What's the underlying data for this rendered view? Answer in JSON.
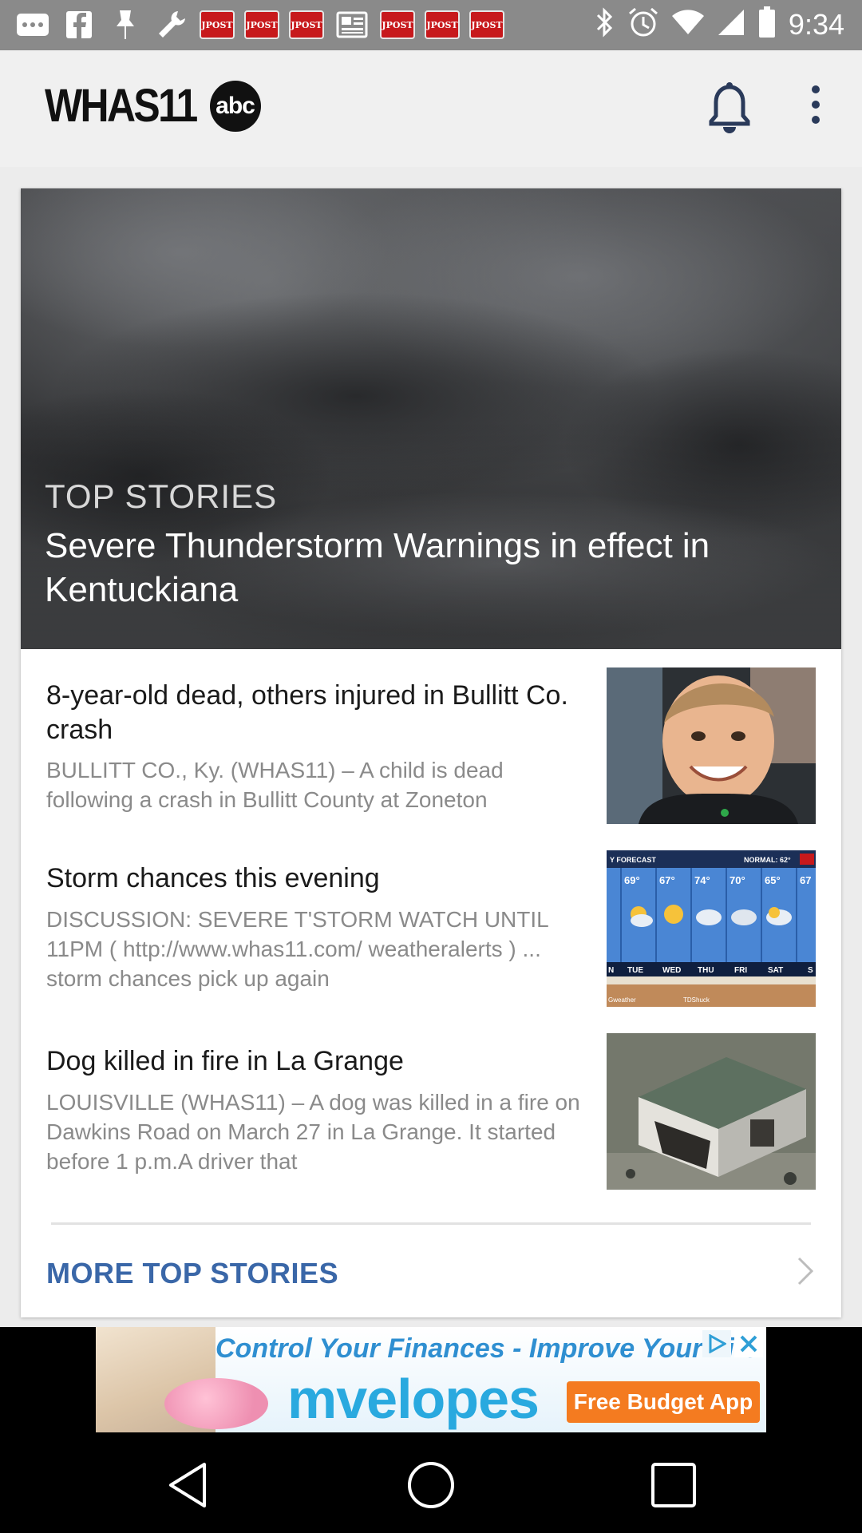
{
  "status_bar": {
    "time": "9:34",
    "notification_labels": [
      "JPOST",
      "JPOST",
      "JPOST",
      "JPOST",
      "JPOST",
      "JPOST"
    ]
  },
  "app_bar": {
    "logo_text": "WHAS11",
    "logo_badge": "abc"
  },
  "hero": {
    "kicker": "TOP STORIES",
    "title": "Severe Thunderstorm Warnings in effect in Kentuckiana"
  },
  "stories": [
    {
      "title": "8-year-old dead, others injured in Bullitt Co. crash",
      "summary": "BULLITT CO., Ky. (WHAS11) –  A child is dead following a crash in Bullitt County at Zoneton"
    },
    {
      "title": "Storm chances this evening",
      "summary": "DISCUSSION:   SEVERE T'STORM WATCH UNTIL 11PM (  http://www.whas11.com/ weatheralerts )  ...  storm chances pick up again"
    },
    {
      "title": "Dog killed in fire in La Grange",
      "summary": "LOUISVILLE (WHAS11) – A dog was killed in a fire on Dawkins Road on March 27 in La Grange. It started before 1 p.m.A driver that"
    }
  ],
  "weather_thumb": {
    "header_left": "Y FORECAST",
    "header_right": "NORMAL: 62°",
    "days": [
      "N",
      "TUE",
      "WED",
      "THU",
      "FRI",
      "SAT",
      "S"
    ],
    "temps": [
      "69°",
      "67°",
      "74°",
      "70°",
      "65°",
      "67"
    ],
    "footer_left": "Gweather",
    "footer_right": "TDShuck"
  },
  "more_link": "MORE TOP STORIES",
  "ad": {
    "line1": "Control Your Finances - Improve Your Life",
    "brand": "mvelopes",
    "cta": "Free Budget App"
  },
  "colors": {
    "link_blue": "#3a67a8",
    "jpost_red": "#c7191c",
    "ad_orange": "#f47b20"
  }
}
